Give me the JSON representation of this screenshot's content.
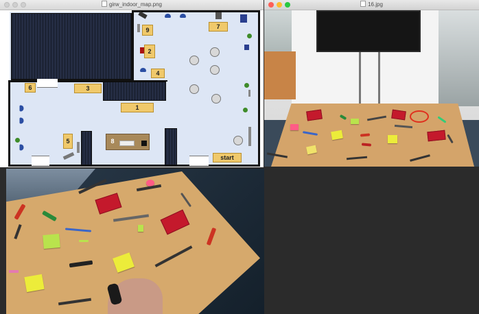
{
  "windows": {
    "map": {
      "title": "girw_indoor_map.png",
      "labels": {
        "l1": "1",
        "l2": "2",
        "l3": "3",
        "l4": "4",
        "l5": "5",
        "l6": "6",
        "l7": "7",
        "l8": "8",
        "l9": "9",
        "start": "start"
      }
    },
    "photo": {
      "title": "16.jpg"
    }
  },
  "colors": {
    "desktop": "#2b2b2b",
    "room_floor": "#dde6f5",
    "label_fill": "#f0c96b",
    "table_top": "#d4a46a"
  }
}
